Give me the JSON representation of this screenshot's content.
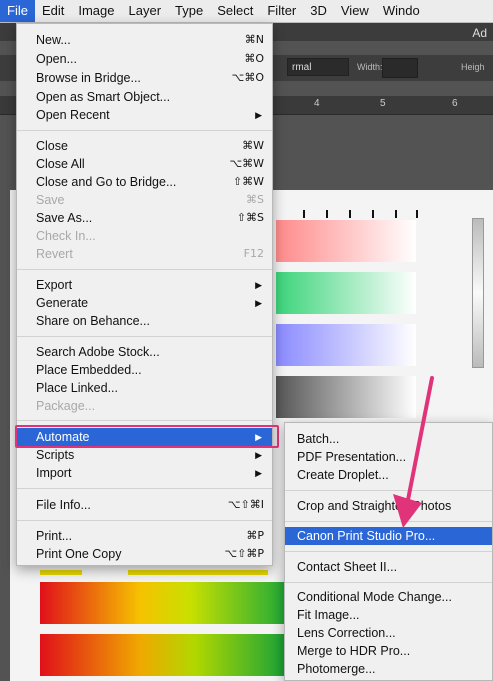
{
  "menubar": [
    "File",
    "Edit",
    "Image",
    "Layer",
    "Type",
    "Select",
    "Filter",
    "3D",
    "View",
    "Windo"
  ],
  "workspace": {
    "title_fragment": "Ad",
    "mode_value": "rmal",
    "width_label": "Width:",
    "height_label": "Heigh",
    "ruler_numbers": [
      "4",
      "5",
      "6"
    ]
  },
  "file_menu": {
    "items": [
      {
        "label": "New...",
        "shortcut": "⌘N"
      },
      {
        "label": "Open...",
        "shortcut": "⌘O"
      },
      {
        "label": "Browse in Bridge...",
        "shortcut": "⌥⌘O"
      },
      {
        "label": "Open as Smart Object...",
        "shortcut": ""
      },
      {
        "label": "Open Recent",
        "shortcut": "",
        "submenu": true
      },
      {
        "label": "Close",
        "shortcut": "⌘W"
      },
      {
        "label": "Close All",
        "shortcut": "⌥⌘W"
      },
      {
        "label": "Close and Go to Bridge...",
        "shortcut": "⇧⌘W"
      },
      {
        "label": "Save",
        "shortcut": "⌘S",
        "disabled": true
      },
      {
        "label": "Save As...",
        "shortcut": "⇧⌘S"
      },
      {
        "label": "Check In...",
        "shortcut": "",
        "disabled": true
      },
      {
        "label": "Revert",
        "shortcut": "F12",
        "disabled": true
      },
      {
        "label": "Export",
        "shortcut": "",
        "submenu": true
      },
      {
        "label": "Generate",
        "shortcut": "",
        "submenu": true
      },
      {
        "label": "Share on Behance...",
        "shortcut": ""
      },
      {
        "label": "Search Adobe Stock...",
        "shortcut": ""
      },
      {
        "label": "Place Embedded...",
        "shortcut": ""
      },
      {
        "label": "Place Linked...",
        "shortcut": ""
      },
      {
        "label": "Package...",
        "shortcut": "",
        "disabled": true
      },
      {
        "label": "Automate",
        "shortcut": "",
        "submenu": true,
        "highlighted": true
      },
      {
        "label": "Scripts",
        "shortcut": "",
        "submenu": true
      },
      {
        "label": "Import",
        "shortcut": "",
        "submenu": true
      },
      {
        "label": "File Info...",
        "shortcut": "⌥⇧⌘I"
      },
      {
        "label": "Print...",
        "shortcut": "⌘P"
      },
      {
        "label": "Print One Copy",
        "shortcut": "⌥⇧⌘P"
      }
    ]
  },
  "automate_menu": {
    "items": [
      {
        "label": "Batch..."
      },
      {
        "label": "PDF Presentation..."
      },
      {
        "label": "Create Droplet..."
      },
      {
        "label": "Crop and Straighten Photos"
      },
      {
        "label": "Canon Print Studio Pro...",
        "highlighted": true
      },
      {
        "label": "Contact Sheet II..."
      },
      {
        "label": "Conditional Mode Change..."
      },
      {
        "label": "Fit Image..."
      },
      {
        "label": "Lens Correction..."
      },
      {
        "label": "Merge to HDR Pro..."
      },
      {
        "label": "Photomerge..."
      }
    ]
  },
  "colors": {
    "menu_highlight": "#2a66d6",
    "annotation": "#e0337a"
  }
}
